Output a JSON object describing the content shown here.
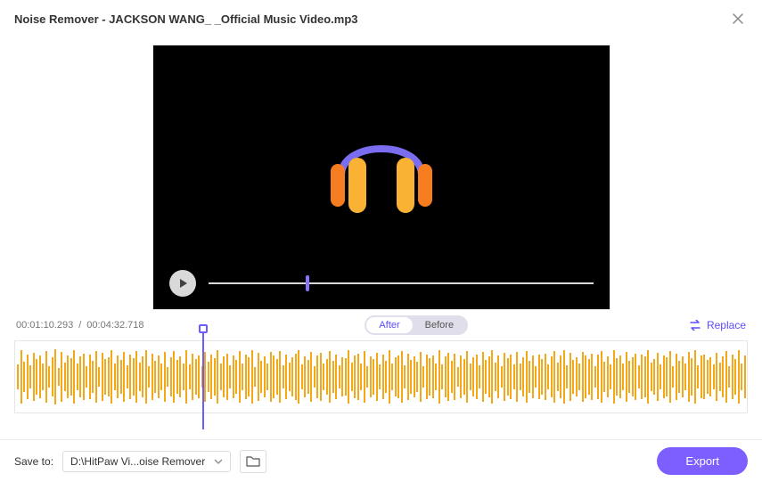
{
  "title": "Noise Remover - JACKSON WANG_ _Official Music Video.mp3",
  "time": {
    "current": "00:01:10.293",
    "sep": "/",
    "total": "00:04:32.718"
  },
  "toggle": {
    "after": "After",
    "before": "Before"
  },
  "replace": "Replace",
  "footer": {
    "saveToLabel": "Save to:",
    "path": "D:\\HitPaw Vi...oise Remover",
    "export": "Export"
  },
  "progress": {
    "percent": 25.3
  },
  "playheadPercent": 26.5,
  "waveform": [
    28,
    60,
    34,
    50,
    26,
    54,
    40,
    48,
    30,
    58,
    24,
    44,
    62,
    20,
    56,
    32,
    48,
    42,
    60,
    30,
    46,
    52,
    24,
    50,
    36,
    58,
    22,
    54,
    40,
    44,
    60,
    30,
    48,
    38,
    56,
    26,
    50,
    42,
    58,
    32,
    46,
    60,
    24,
    52,
    36,
    48,
    30,
    56,
    22,
    44,
    58,
    38,
    46,
    30,
    60,
    28,
    52,
    40,
    48,
    24,
    56,
    34,
    50,
    42,
    60,
    30,
    46,
    52,
    26,
    48,
    38,
    58,
    30,
    50,
    44,
    60,
    22,
    54,
    36,
    46,
    30,
    56,
    48,
    40,
    58,
    26,
    50,
    32,
    44,
    52,
    60,
    28,
    46,
    38,
    56,
    24,
    48,
    54,
    30,
    40,
    58,
    36,
    50,
    26,
    44,
    42,
    60,
    32,
    48,
    52,
    30,
    58,
    24,
    46,
    40,
    54,
    28,
    50,
    36,
    60,
    30,
    44,
    48,
    58,
    26,
    52,
    38,
    46,
    34,
    56,
    24,
    50,
    42,
    48,
    30,
    60,
    28,
    46,
    54,
    36,
    52,
    22,
    48,
    40,
    58,
    30,
    44,
    50,
    26,
    56,
    38,
    46,
    60,
    32,
    48,
    24,
    54,
    42,
    50,
    28,
    56,
    30,
    44,
    58,
    36,
    48,
    24,
    50,
    40,
    52,
    28,
    46,
    58,
    32,
    48,
    60,
    26,
    54,
    38,
    44,
    30,
    56,
    48,
    40,
    52,
    24,
    50,
    58,
    34,
    46,
    28,
    60,
    42,
    48,
    30,
    56,
    36,
    44,
    52,
    26,
    50,
    46,
    60,
    32,
    40,
    54,
    28,
    48,
    44,
    58,
    24,
    52,
    36,
    46,
    30,
    56,
    42,
    60,
    26,
    48,
    50,
    38,
    44,
    28,
    54,
    32,
    46,
    58,
    24,
    50,
    40,
    60,
    30,
    48
  ]
}
